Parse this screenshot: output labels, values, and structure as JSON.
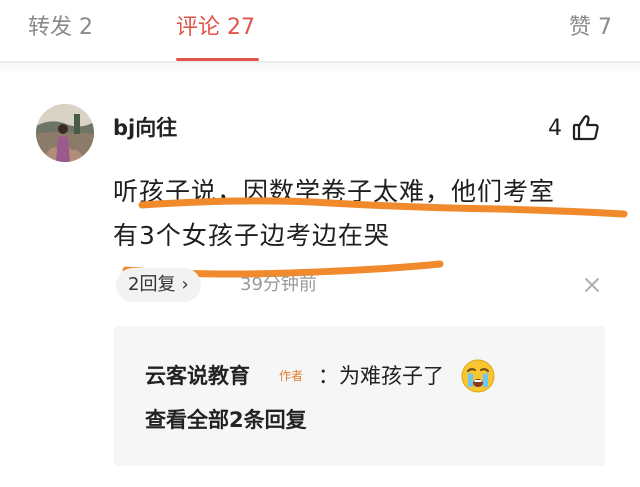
{
  "tabs": {
    "repost": "转发 2",
    "comment": "评论 27",
    "like": "赞 7"
  },
  "accent_color": "#e0544c",
  "comment": {
    "username": "bj向往",
    "like_count": "4",
    "text_line1": "听孩子说，因数学卷子太难，他们考室",
    "text_line2": "有3个女孩子边考边在哭",
    "reply_pill": "2回复",
    "time": "39分钟前"
  },
  "replies": {
    "author": "云客说教育",
    "author_tag": "作者",
    "text": "：为难孩子了",
    "view_all": "查看全部2条回复"
  },
  "icons": {
    "like": "thumbs-up-icon",
    "close": "close-icon",
    "emoji": "crying-face-icon",
    "chevron": "chevron-right-icon"
  }
}
